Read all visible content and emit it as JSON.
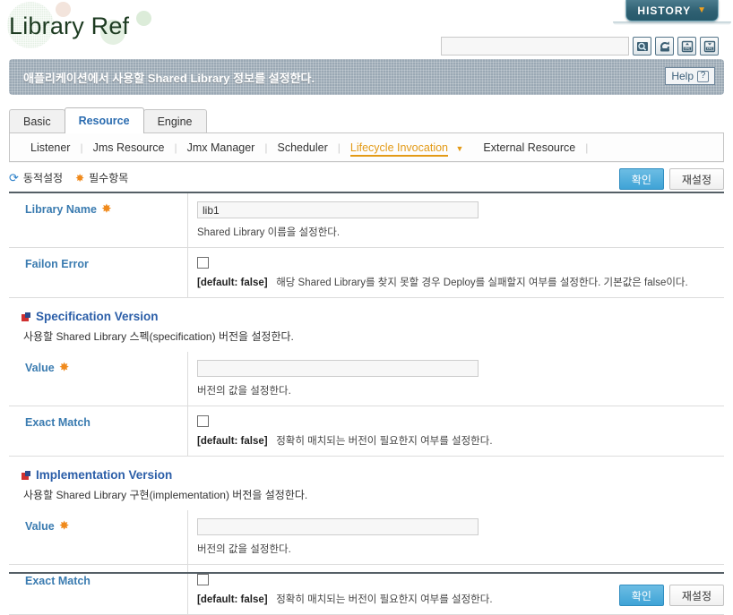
{
  "header": {
    "title": "Library Ref",
    "history_label": "HISTORY",
    "history_caret": "▼",
    "banner_text": "애플리케이션에서 사용할 Shared Library 정보를 설정한다.",
    "help_label": "Help",
    "help_mark": "?"
  },
  "search": {
    "value": "",
    "placeholder": "",
    "icons": [
      "search-icon",
      "refresh-icon",
      "xml-import-icon",
      "xml-export-icon"
    ]
  },
  "tabs": [
    {
      "label": "Basic",
      "active": false
    },
    {
      "label": "Resource",
      "active": true
    },
    {
      "label": "Engine",
      "active": false
    }
  ],
  "subtabs": [
    {
      "label": "Listener",
      "active": false,
      "caret": ""
    },
    {
      "label": "Jms Resource",
      "active": false,
      "caret": ""
    },
    {
      "label": "Jmx Manager",
      "active": false,
      "caret": ""
    },
    {
      "label": "Scheduler",
      "active": false,
      "caret": ""
    },
    {
      "label": "Lifecycle Invocation",
      "active": true,
      "caret": "▼"
    },
    {
      "label": "External Resource",
      "active": false,
      "caret": ""
    }
  ],
  "legend": {
    "dynamic_icon": "⟳",
    "dynamic_label": "동적설정",
    "required_icon": "✸",
    "required_label": "필수항목"
  },
  "buttons": {
    "confirm": "확인",
    "reset": "재설정"
  },
  "form": {
    "rows": [
      {
        "label": "Library Name",
        "required": true,
        "type": "text",
        "value": "lib1",
        "hint_bold": "",
        "hint": "Shared Library 이름을 설정한다."
      },
      {
        "label": "Failon Error",
        "required": false,
        "type": "checkbox",
        "checked": false,
        "hint_bold": "[default: false]",
        "hint": "해당 Shared Library를 찾지 못할 경우 Deploy를 실패할지 여부를 설정한다. 기본값은 false이다."
      }
    ],
    "sections": [
      {
        "title": "Specification Version",
        "desc": "사용할 Shared Library 스펙(specification) 버전을 설정한다.",
        "rows": [
          {
            "label": "Value",
            "required": true,
            "type": "text",
            "value": "",
            "hint_bold": "",
            "hint": "버전의 값을 설정한다."
          },
          {
            "label": "Exact Match",
            "required": false,
            "type": "checkbox",
            "checked": false,
            "hint_bold": "[default: false]",
            "hint": "정확히 매치되는 버전이 필요한지 여부를 설정한다."
          }
        ]
      },
      {
        "title": "Implementation Version",
        "desc": "사용할 Shared Library 구현(implementation) 버전을 설정한다.",
        "rows": [
          {
            "label": "Value",
            "required": true,
            "type": "text",
            "value": "",
            "hint_bold": "",
            "hint": "버전의 값을 설정한다."
          },
          {
            "label": "Exact Match",
            "required": false,
            "type": "checkbox",
            "checked": false,
            "hint_bold": "[default: false]",
            "hint": "정확히 매치되는 버전이 필요한지 여부를 설정한다."
          }
        ]
      }
    ]
  },
  "colors": {
    "accent_blue": "#3a7bb0",
    "active_orange": "#e39a16",
    "required_orange": "#f08a1c",
    "tab_active": "#2b6cb0",
    "banner_bg": "#9aa8b4",
    "history_bg": "#2f6072"
  }
}
